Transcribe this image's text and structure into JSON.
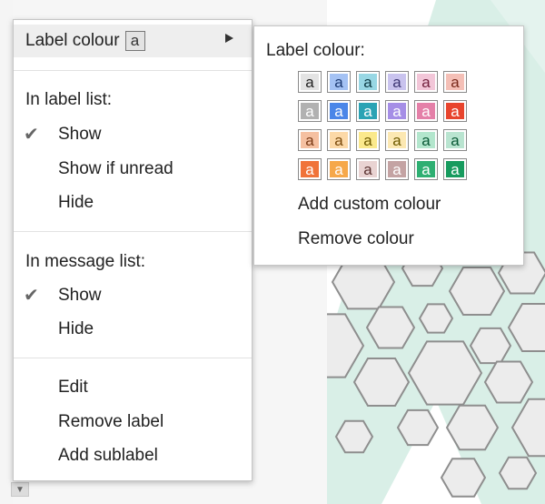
{
  "menu": {
    "label_colour": {
      "label": "Label colour",
      "swatch": "a",
      "arrow_icon": "triangle-right-icon"
    },
    "label_list": {
      "title": "In label list:",
      "checked_icon": "checkmark-icon",
      "options": [
        "Show",
        "Show if unread",
        "Hide"
      ],
      "selected_index": 0
    },
    "message_list": {
      "title": "In message list:",
      "options": [
        "Show",
        "Hide"
      ],
      "selected_index": 0
    },
    "actions": [
      "Edit",
      "Remove label",
      "Add sublabel"
    ]
  },
  "submenu": {
    "title": "Label colour:",
    "swatch_letter": "a",
    "swatches": [
      [
        {
          "bg": "#e3e3e3",
          "fg": "#222222"
        },
        {
          "bg": "#a4c2f4",
          "fg": "#1c3a73"
        },
        {
          "bg": "#98d7e4",
          "fg": "#0d3b44"
        },
        {
          "bg": "#c9c3ee",
          "fg": "#3d3673"
        },
        {
          "bg": "#f2c6d8",
          "fg": "#73213f"
        },
        {
          "bg": "#f4bfb6",
          "fg": "#7a2a1c"
        }
      ],
      [
        {
          "bg": "#b1b1b1",
          "fg": "#ffffff"
        },
        {
          "bg": "#4a86e8",
          "fg": "#ffffff"
        },
        {
          "bg": "#2aa3b4",
          "fg": "#ffffff"
        },
        {
          "bg": "#a58ee6",
          "fg": "#ffffff"
        },
        {
          "bg": "#e480a8",
          "fg": "#ffffff"
        },
        {
          "bg": "#e8442d",
          "fg": "#ffffff"
        }
      ],
      [
        {
          "bg": "#f5c0a1",
          "fg": "#7a3a16"
        },
        {
          "bg": "#fcd9a8",
          "fg": "#7a4a0c"
        },
        {
          "bg": "#fbe98c",
          "fg": "#6e5a00"
        },
        {
          "bg": "#fce8b2",
          "fg": "#6e5a00"
        },
        {
          "bg": "#b3e6cd",
          "fg": "#0b5a37"
        },
        {
          "bg": "#b9e4d0",
          "fg": "#0b5a37"
        }
      ],
      [
        {
          "bg": "#f0733a",
          "fg": "#ffffff"
        },
        {
          "bg": "#f6a84a",
          "fg": "#ffffff"
        },
        {
          "bg": "#e9d3d2",
          "fg": "#5a3331"
        },
        {
          "bg": "#c4a3a3",
          "fg": "#ffffff"
        },
        {
          "bg": "#2eaf72",
          "fg": "#ffffff"
        },
        {
          "bg": "#179b5e",
          "fg": "#ffffff"
        }
      ]
    ],
    "add_custom": "Add custom colour",
    "remove": "Remove colour"
  },
  "background": {
    "scroll_icon": "triangle-down-icon",
    "accent_teal": "#cfe9e1"
  }
}
